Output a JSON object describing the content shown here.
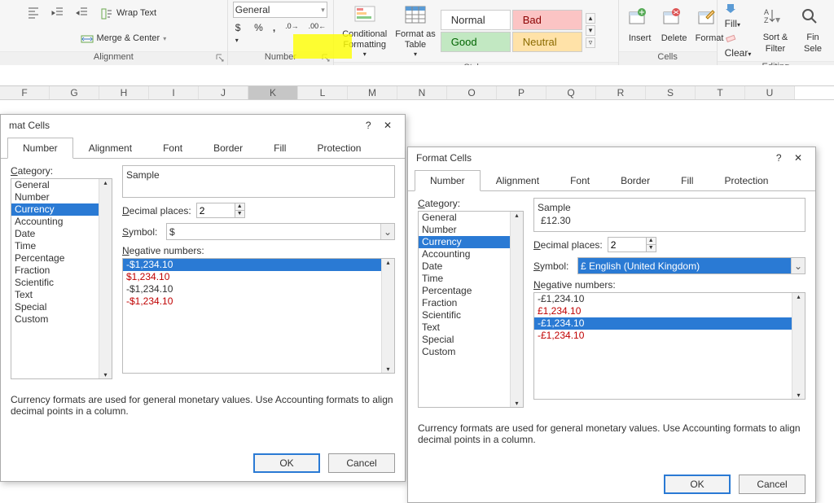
{
  "ribbon": {
    "alignment": {
      "wrap_text": "Wrap Text",
      "merge_center": "Merge & Center",
      "label": "Alignment"
    },
    "number": {
      "format_combo": "General",
      "label": "Number"
    },
    "styles": {
      "conditional": "Conditional\nFormatting",
      "format_table": "Format as\nTable",
      "normal": "Normal",
      "bad": "Bad",
      "good": "Good",
      "neutral": "Neutral",
      "label": "Styles"
    },
    "cells": {
      "insert": "Insert",
      "delete": "Delete",
      "format": "Format",
      "label": "Cells"
    },
    "editing": {
      "fill": "Fill",
      "clear": "Clear",
      "sort_filter": "Sort &\nFilter",
      "find_select": "Fin\nSele",
      "label": "Editing"
    }
  },
  "sheet": {
    "cols": [
      "F",
      "G",
      "H",
      "I",
      "J",
      "K",
      "L",
      "M",
      "N",
      "O",
      "P",
      "Q",
      "R",
      "S",
      "T",
      "U"
    ],
    "selected": "K"
  },
  "dialog1": {
    "title": "mat Cells",
    "tabs": [
      "Number",
      "Alignment",
      "Font",
      "Border",
      "Fill",
      "Protection"
    ],
    "active_tab": "Number",
    "category_label": "Category:",
    "categories": [
      "General",
      "Number",
      "Currency",
      "Accounting",
      "Date",
      "Time",
      "Percentage",
      "Fraction",
      "Scientific",
      "Text",
      "Special",
      "Custom"
    ],
    "sel_category": "Currency",
    "sample_label": "Sample",
    "sample_value": "",
    "decimal_label": "Decimal places:",
    "decimal_value": "2",
    "symbol_label": "Symbol:",
    "symbol_value": "$",
    "neg_label": "Negative numbers:",
    "neg_numbers": [
      {
        "text": "-$1,234.10",
        "sel": true,
        "color": "black"
      },
      {
        "text": "$1,234.10",
        "sel": false,
        "color": "red"
      },
      {
        "text": "-$1,234.10",
        "sel": false,
        "color": "black"
      },
      {
        "text": "-$1,234.10",
        "sel": false,
        "color": "red"
      }
    ],
    "help_text": "Currency formats are used for general monetary values.  Use Accounting formats to align decimal points in a column.",
    "ok": "OK",
    "cancel": "Cancel"
  },
  "dialog2": {
    "title": "Format Cells",
    "tabs": [
      "Number",
      "Alignment",
      "Font",
      "Border",
      "Fill",
      "Protection"
    ],
    "active_tab": "Number",
    "category_label": "Category:",
    "categories": [
      "General",
      "Number",
      "Currency",
      "Accounting",
      "Date",
      "Time",
      "Percentage",
      "Fraction",
      "Scientific",
      "Text",
      "Special",
      "Custom"
    ],
    "sel_category": "Currency",
    "sample_label": "Sample",
    "sample_value": "£12.30",
    "decimal_label": "Decimal places:",
    "decimal_value": "2",
    "symbol_label": "Symbol:",
    "symbol_value": "£ English (United Kingdom)",
    "neg_label": "Negative numbers:",
    "neg_numbers": [
      {
        "text": "-£1,234.10",
        "sel": false,
        "color": "black"
      },
      {
        "text": "£1,234.10",
        "sel": false,
        "color": "red"
      },
      {
        "text": "-£1,234.10",
        "sel": true,
        "color": "black"
      },
      {
        "text": "-£1,234.10",
        "sel": false,
        "color": "red"
      }
    ],
    "help_text": "Currency formats are used for general monetary values.  Use Accounting formats to align decimal points in a column.",
    "ok": "OK",
    "cancel": "Cancel"
  }
}
